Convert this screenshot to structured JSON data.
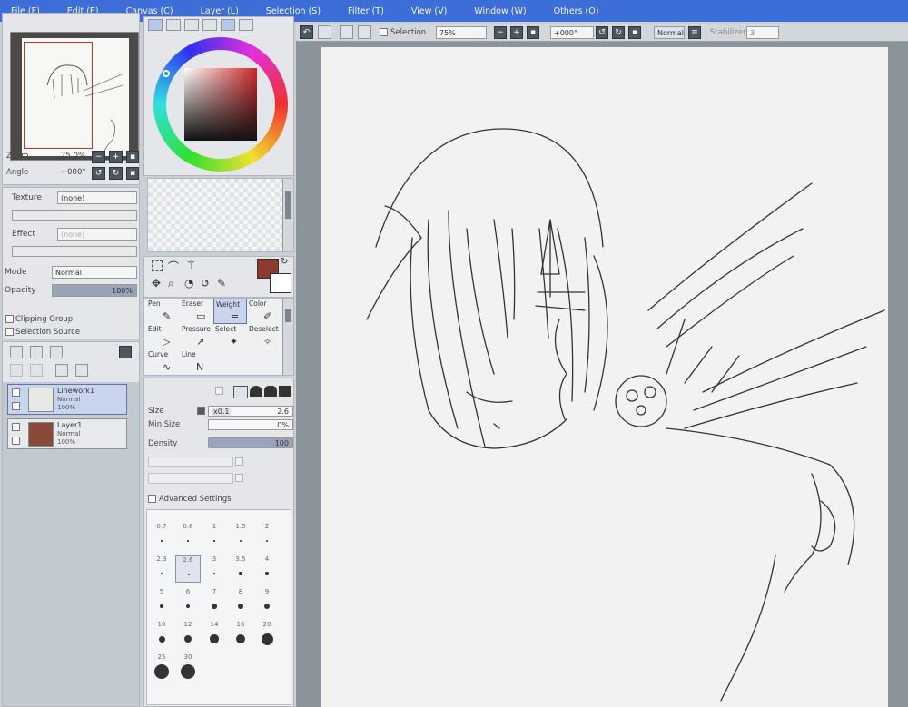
{
  "menu": [
    "File (F)",
    "Edit (E)",
    "Canvas (C)",
    "Layer (L)",
    "Selection (S)",
    "Filter (T)",
    "View (V)",
    "Window (W)",
    "Others (O)"
  ],
  "navigator": {
    "zoom_label": "Zoom",
    "zoom_value": "75.0%",
    "angle_label": "Angle",
    "angle_value": "+000°"
  },
  "layer_props": {
    "texture_label": "Texture",
    "texture_value": "(none)",
    "effect_label": "Effect",
    "effect_value": "(none)",
    "mode_label": "Mode",
    "mode_value": "Normal",
    "opacity_label": "Opacity",
    "opacity_value": "100%",
    "opacity_fraction": 1.0,
    "clipping_label": "Clipping Group",
    "selection_source_label": "Selection Source"
  },
  "layers": [
    {
      "name": "Linework1",
      "mode": "Normal",
      "opacity": "100%",
      "active": true
    },
    {
      "name": "Layer1",
      "mode": "Normal",
      "opacity": "100%",
      "active": false
    }
  ],
  "tools": [
    {
      "label": "Pen",
      "icon": "pen-icon",
      "glyph": "✎"
    },
    {
      "label": "Eraser",
      "icon": "eraser-icon",
      "glyph": "▭"
    },
    {
      "label": "Weight",
      "icon": "weight-icon",
      "glyph": "≡"
    },
    {
      "label": "Color",
      "icon": "color-icon",
      "glyph": "✐"
    },
    {
      "label": "Edit",
      "icon": "edit-icon",
      "glyph": "▷"
    },
    {
      "label": "Pressure",
      "icon": "pressure-icon",
      "glyph": "↗"
    },
    {
      "label": "Select",
      "icon": "select-icon",
      "glyph": "✦"
    },
    {
      "label": "Deselect",
      "icon": "deselect-icon",
      "glyph": "✧"
    },
    {
      "label": "Curve",
      "icon": "curve-icon",
      "glyph": "∿"
    },
    {
      "label": "Line",
      "icon": "line-icon",
      "glyph": "N"
    }
  ],
  "brush": {
    "size_label": "Size",
    "size_multiplier": "x0.1",
    "size_value": "2.6",
    "min_size_label": "Min Size",
    "min_size_value": "0%",
    "density_label": "Density",
    "density_value": "100",
    "advanced_label": "Advanced Settings",
    "sizes": [
      "0.7",
      "0.8",
      "1",
      "1.5",
      "2",
      "2.3",
      "2.6",
      "3",
      "3.5",
      "4",
      "5",
      "6",
      "7",
      "8",
      "9",
      "10",
      "12",
      "14",
      "16",
      "20",
      "25",
      "30"
    ],
    "selected_size": "2.6"
  },
  "toolbar": {
    "selection_label": "Selection",
    "zoom_value": "75%",
    "angle_value": "+000°",
    "normal_label": "Normal",
    "stabilizer_label": "Stabilizer",
    "stabilizer_value": "3"
  },
  "colors": {
    "current_color": "#8a3a33",
    "menubar": "#3d6dd6"
  }
}
